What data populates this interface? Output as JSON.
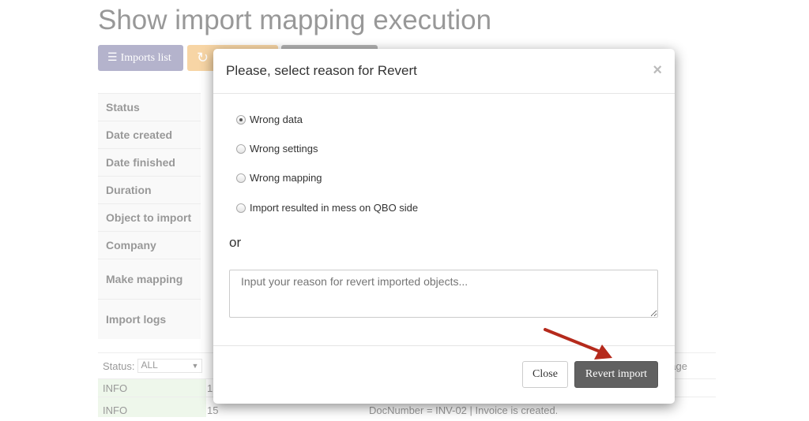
{
  "page": {
    "title": "Show import mapping execution",
    "buttons": [
      {
        "label": "Imports list",
        "icon": "list-icon",
        "color": "#6c6a9a"
      },
      {
        "label": "",
        "icon": "refresh-icon",
        "color": "#f0ad4e"
      },
      {
        "label": "",
        "color": "#666666"
      }
    ],
    "details": [
      "Status",
      "Date created",
      "Date finished",
      "Duration",
      "Object to import",
      "Company",
      "Make mapping",
      "Import logs"
    ],
    "logs": {
      "status_label": "Status:",
      "status_value": "ALL",
      "message_header": "Message",
      "rows": [
        {
          "level": "INFO",
          "id": "1",
          "message": ""
        },
        {
          "level": "INFO",
          "id": "15",
          "message": "DocNumber = INV-02 | Invoice is created."
        }
      ]
    }
  },
  "modal": {
    "title": "Please, select reason for Revert",
    "close_icon": "×",
    "options": [
      {
        "label": "Wrong data",
        "checked": true
      },
      {
        "label": "Wrong settings",
        "checked": false
      },
      {
        "label": "Wrong mapping",
        "checked": false
      },
      {
        "label": "Import resulted in mess on QBO side",
        "checked": false
      }
    ],
    "or_label": "or",
    "reason_placeholder": "Input your reason for revert imported objects...",
    "close_label": "Close",
    "revert_label": "Revert import",
    "arrow_color": "#b52a1c"
  }
}
